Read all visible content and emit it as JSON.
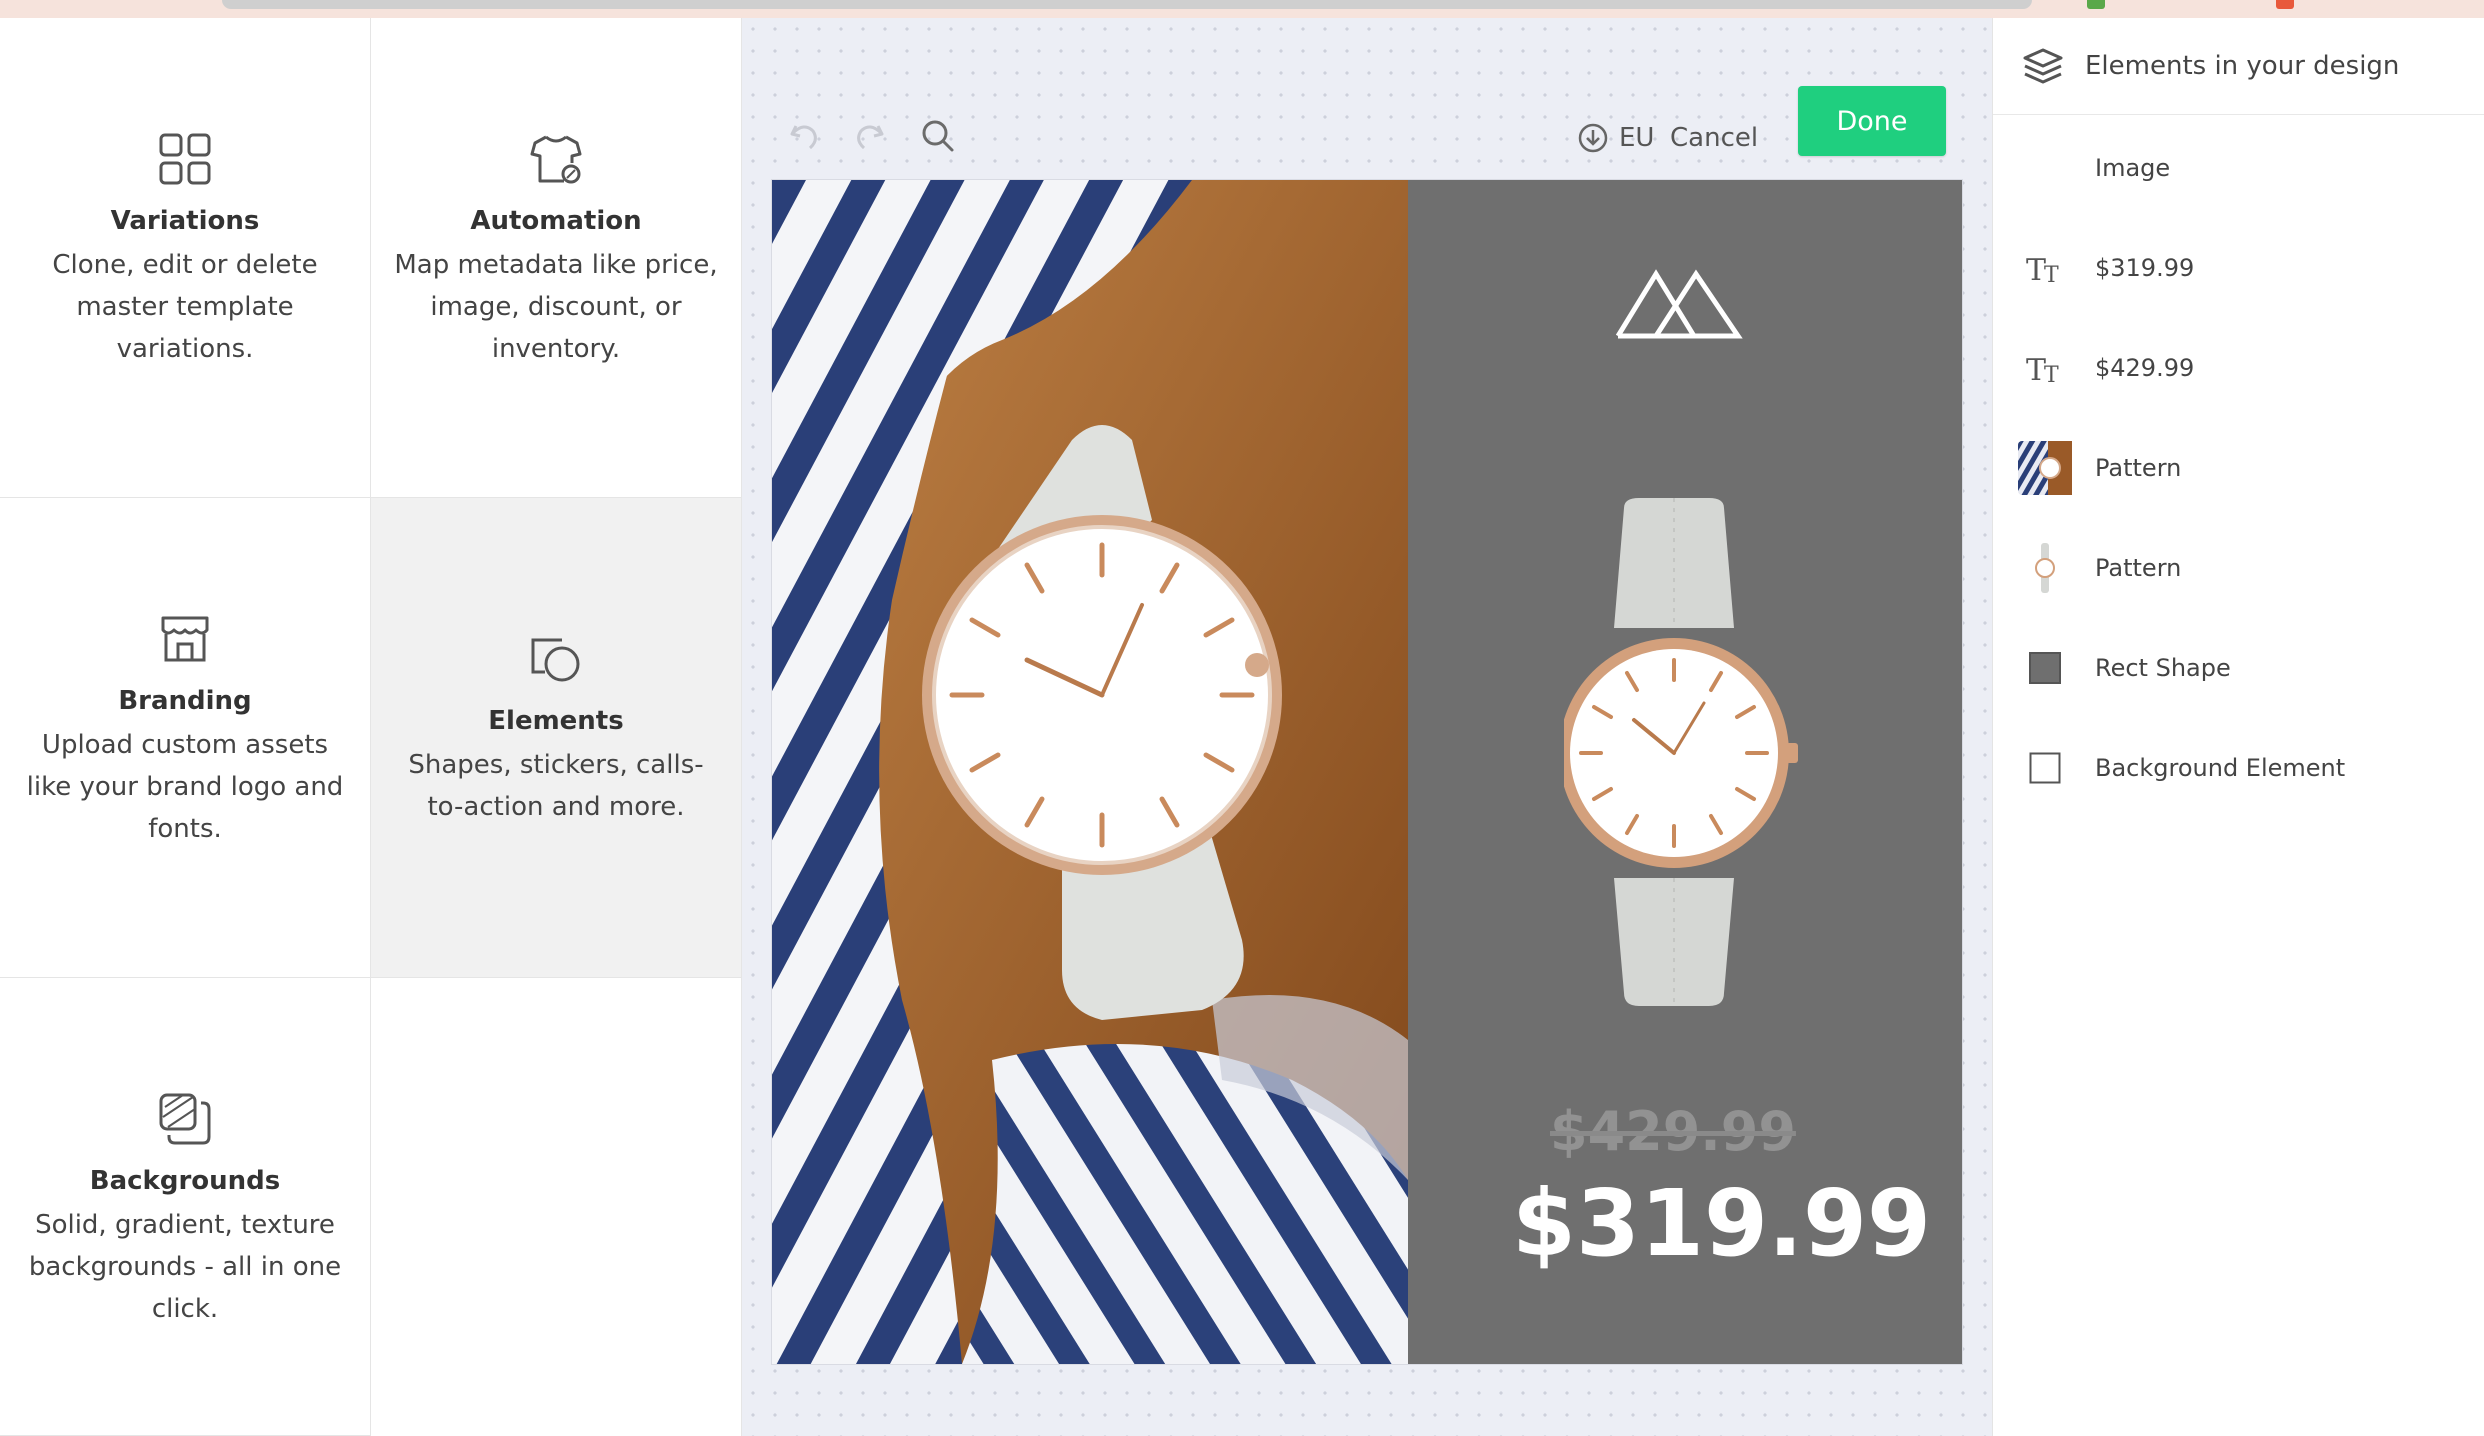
{
  "tiles": [
    {
      "title": "Variations",
      "desc": "Clone, edit or delete master template variations.",
      "icon": "grid-icon"
    },
    {
      "title": "Automation",
      "desc": "Map metadata like price, image, discount, or inventory.",
      "icon": "tshirt-tag-icon"
    },
    {
      "title": "Branding",
      "desc": "Upload custom assets like your brand logo and fonts.",
      "icon": "storefront-icon"
    },
    {
      "title": "Elements",
      "desc": "Shapes, stickers, calls-to-action and more.",
      "icon": "shapes-icon"
    },
    {
      "title": "Backgrounds",
      "desc": "Solid, gradient, texture backgrounds - all in one click.",
      "icon": "layers-stack-icon"
    }
  ],
  "toolbar": {
    "eu_label": "EU",
    "cancel_label": "Cancel",
    "done_label": "Done"
  },
  "design": {
    "old_price": "$429.99",
    "new_price": "$319.99"
  },
  "layers_panel": {
    "title": "Elements in your design",
    "items": [
      {
        "label": "Image",
        "icon": "none"
      },
      {
        "label": "$319.99",
        "icon": "text-icon"
      },
      {
        "label": "$429.99",
        "icon": "text-icon"
      },
      {
        "label": "Pattern",
        "icon": "photo-thumbnail"
      },
      {
        "label": "Pattern",
        "icon": "watch-thumbnail"
      },
      {
        "label": "Rect Shape",
        "icon": "filled-square-icon"
      },
      {
        "label": "Background Element",
        "icon": "outlined-square-icon"
      }
    ]
  },
  "colors": {
    "done_button": "#1fcf7f",
    "rect_shape": "#6f6f6f",
    "canvas_bg": "#eceef5"
  }
}
